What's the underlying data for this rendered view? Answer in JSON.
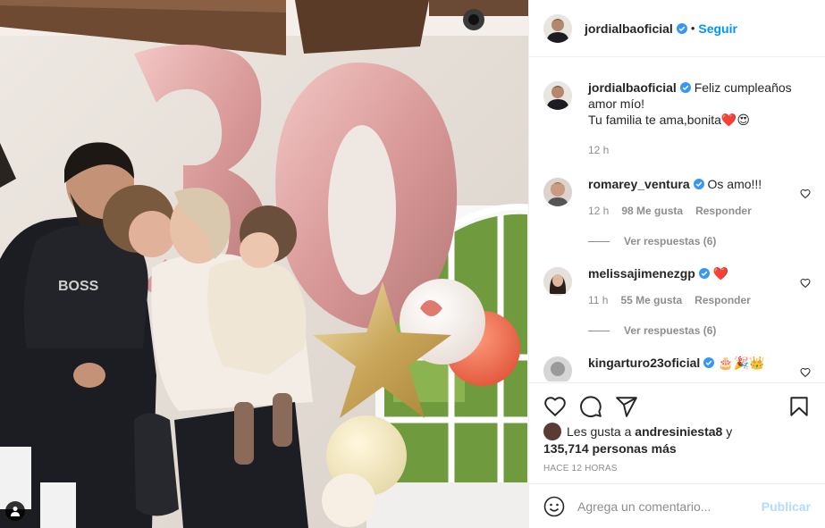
{
  "post": {
    "username": "jordialbaoficial",
    "follow_label": "Seguir",
    "separator": "•",
    "caption_line1": "Feliz cumpleaños amor mío!",
    "caption_line2": "Tu familia te ama,bonita",
    "caption_emojis": "❤️😍",
    "caption_time": "12 h"
  },
  "comments": [
    {
      "username": "romarey_ventura",
      "text": "Os amo!!!",
      "time": "12 h",
      "likes": "98 Me gusta",
      "reply_label": "Responder",
      "view_replies": "Ver respuestas (6)"
    },
    {
      "username": "melissajimenezgp",
      "text": "❤️",
      "time": "11 h",
      "likes": "55 Me gusta",
      "reply_label": "Responder",
      "view_replies": "Ver respuestas (6)"
    },
    {
      "username": "kingarturo23oficial",
      "text": "🎂🎉👑"
    }
  ],
  "likes": {
    "prefix": "Les gusta a",
    "first_user": "andresiniesta8",
    "connector": "y",
    "others": "135,714 personas más"
  },
  "timestamp": "HACE 12 HORAS",
  "add_comment": {
    "placeholder": "Agrega un comentario...",
    "publish_label": "Publicar"
  },
  "colors": {
    "link_blue": "#0095f6",
    "publish_disabled": "#b3dbff",
    "verified_blue": "#3897f0",
    "heart_red": "#ed4956"
  },
  "icons": [
    "heart-icon",
    "comment-icon",
    "share-icon",
    "save-icon",
    "emoji-icon",
    "verified-icon",
    "user-tag-icon"
  ]
}
